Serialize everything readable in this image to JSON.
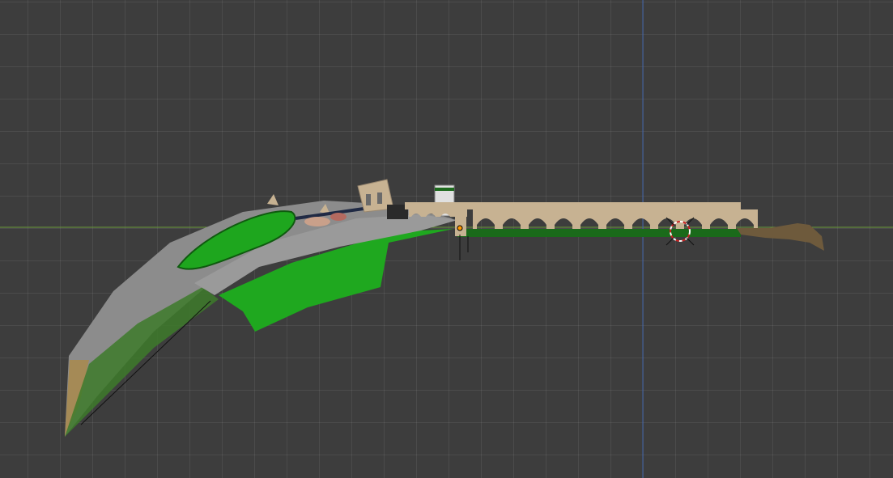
{
  "viewport": {
    "background": "#3d3d3d",
    "grid_line": "rgba(255,255,255,0.07)",
    "x_axis_color": "#6a9c3a",
    "y_axis_color": "#3f62a8"
  },
  "model": {
    "body_gray": "#8c8c8c",
    "body_green": "#1fa81f",
    "bridge_tan": "#c7b292",
    "blade_tan": "#a58a56",
    "strip_green": "#1a6a1a",
    "tip_brown": "#6e5a3c"
  },
  "markers": {
    "origin_color": "#ff9900",
    "cursor_icon": "3d-cursor-icon"
  }
}
